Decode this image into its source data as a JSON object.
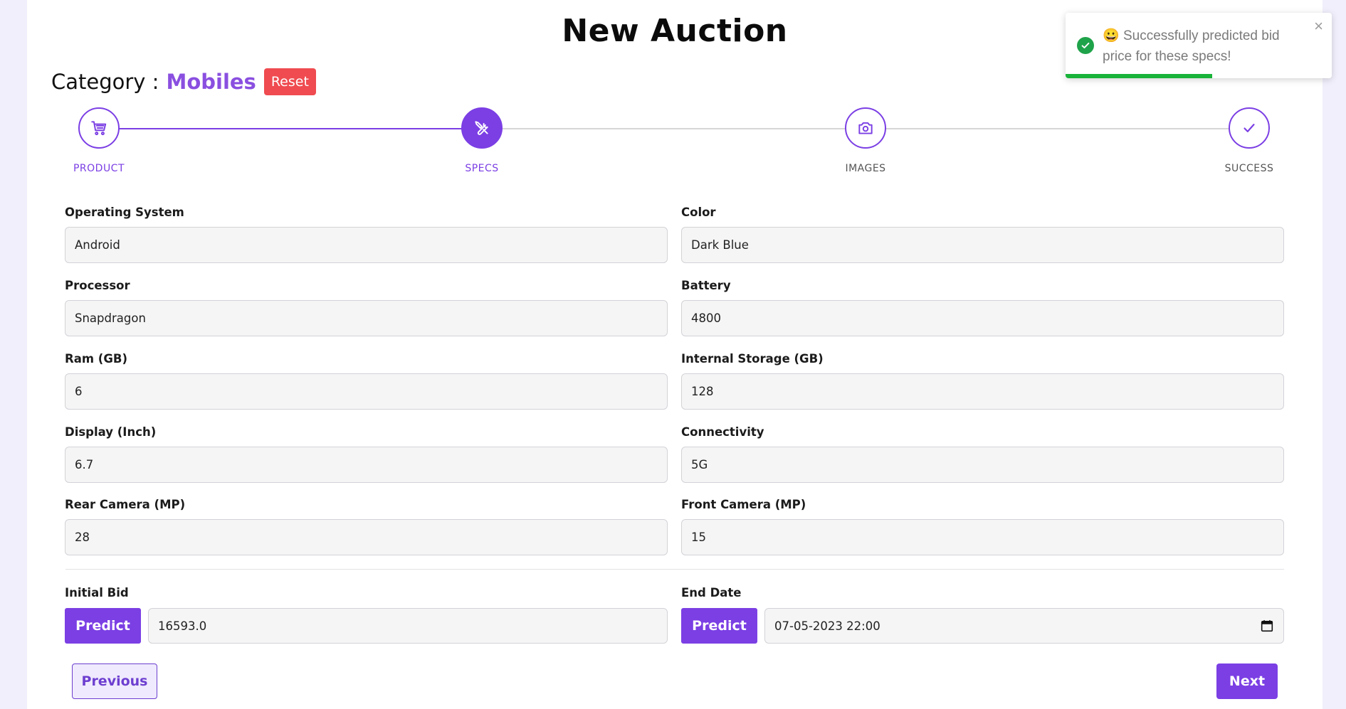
{
  "page": {
    "title": "New Auction"
  },
  "category": {
    "label": "Category :",
    "value": "Mobiles",
    "reset_label": "Reset"
  },
  "stepper": {
    "steps": [
      {
        "label": "PRODUCT",
        "icon": "cart-icon",
        "state": "done"
      },
      {
        "label": "SPECS",
        "icon": "tools-icon",
        "state": "active"
      },
      {
        "label": "IMAGES",
        "icon": "camera-icon",
        "state": "pending"
      },
      {
        "label": "SUCCESS",
        "icon": "check-icon",
        "state": "pending"
      }
    ]
  },
  "form": {
    "operating_system": {
      "label": "Operating System",
      "value": "Android"
    },
    "color": {
      "label": "Color",
      "value": "Dark Blue"
    },
    "processor": {
      "label": "Processor",
      "value": "Snapdragon"
    },
    "battery": {
      "label": "Battery",
      "value": "4800"
    },
    "ram": {
      "label": "Ram (GB)",
      "value": "6"
    },
    "internal_storage": {
      "label": "Internal Storage (GB)",
      "value": "128"
    },
    "display": {
      "label": "Display (Inch)",
      "value": "6.7"
    },
    "connectivity": {
      "label": "Connectivity",
      "value": "5G"
    },
    "rear_camera": {
      "label": "Rear Camera (MP)",
      "value": "28"
    },
    "front_camera": {
      "label": "Front Camera (MP)",
      "value": "15"
    },
    "initial_bid": {
      "label": "Initial Bid",
      "value": "16593.0",
      "predict_label": "Predict"
    },
    "end_date": {
      "label": "End Date",
      "value": "07-05-2023 22:00",
      "predict_label": "Predict"
    }
  },
  "nav": {
    "previous_label": "Previous",
    "next_label": "Next"
  },
  "toast": {
    "emoji": "😀",
    "message": "Successfully predicted bid price for these specs!",
    "close_label": "×",
    "progress": 0.55
  },
  "colors": {
    "accent": "#7b3fe4",
    "reset": "#ef4b50",
    "success": "#1fa34a"
  }
}
